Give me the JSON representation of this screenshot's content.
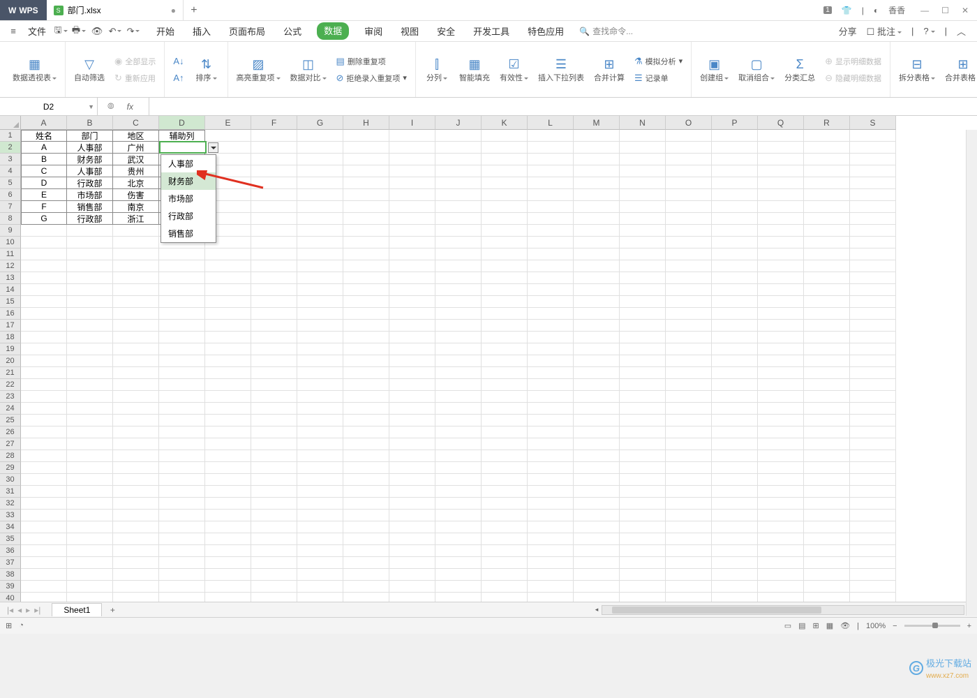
{
  "app": {
    "name": "WPS",
    "filename": "部门.xlsx",
    "user": "香香"
  },
  "title_right": {
    "badge": "1"
  },
  "file_menu": "文件",
  "menu_tabs": [
    "开始",
    "插入",
    "页面布局",
    "公式",
    "数据",
    "审阅",
    "视图",
    "安全",
    "开发工具",
    "特色应用"
  ],
  "active_tab_index": 4,
  "search_placeholder": "查找命令...",
  "menu_right": {
    "share": "分享",
    "annotate": "批注"
  },
  "ribbon": {
    "pivot": "数据透视表",
    "autofilter": "自动筛选",
    "show_all": "全部显示",
    "reapply": "重新应用",
    "sort": "排序",
    "highlight_dup": "高亮重复项",
    "data_compare": "数据对比",
    "del_dup": "删除重复项",
    "reject_dup": "拒绝录入重复项",
    "text_to_cols": "分列",
    "smart_fill": "智能填充",
    "validity": "有效性",
    "insert_dropdown": "插入下拉列表",
    "consolidate": "合并计算",
    "what_if": "模拟分析",
    "record_form": "记录单",
    "group": "创建组",
    "ungroup": "取消组合",
    "subtotal": "分类汇总",
    "show_detail": "显示明细数据",
    "hide_detail": "隐藏明细数据",
    "split_table": "拆分表格",
    "merge_table": "合并表格"
  },
  "name_box": "D2",
  "columns": [
    "A",
    "B",
    "C",
    "D",
    "E",
    "F",
    "G",
    "H",
    "I",
    "J",
    "K",
    "L",
    "M",
    "N",
    "O",
    "P",
    "Q",
    "R",
    "S"
  ],
  "table": {
    "headers": [
      "姓名",
      "部门",
      "地区",
      "辅助列"
    ],
    "rows": [
      [
        "A",
        "人事部",
        "广州",
        ""
      ],
      [
        "B",
        "财务部",
        "武汉",
        ""
      ],
      [
        "C",
        "人事部",
        "贵州",
        ""
      ],
      [
        "D",
        "行政部",
        "北京",
        ""
      ],
      [
        "E",
        "市场部",
        "伤害",
        ""
      ],
      [
        "F",
        "销售部",
        "南京",
        ""
      ],
      [
        "G",
        "行政部",
        "浙江",
        ""
      ]
    ]
  },
  "dropdown_options": [
    "人事部",
    "财务部",
    "市场部",
    "行政部",
    "销售部"
  ],
  "dropdown_hover_index": 1,
  "sheet_tab": "Sheet1",
  "status": {
    "zoom": "100%",
    "minus": "−",
    "plus": "+"
  },
  "watermark": {
    "text": "极光下载站",
    "url": "www.xz7.com"
  }
}
